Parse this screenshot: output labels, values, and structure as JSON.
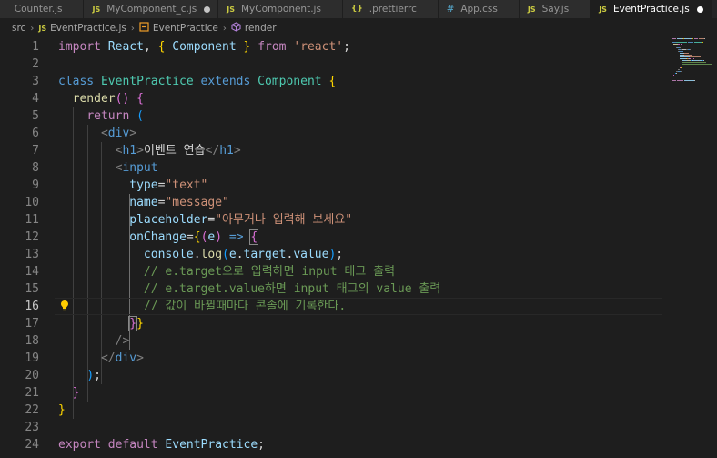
{
  "tabs": [
    {
      "label": "Counter.js",
      "icon": "js-file-icon",
      "active": false,
      "modified": false
    },
    {
      "label": "MyComponent_c.js",
      "icon": "js-file-icon",
      "active": false,
      "modified": true
    },
    {
      "label": "MyComponent.js",
      "icon": "js-file-icon",
      "active": false,
      "modified": false
    },
    {
      "label": ".prettierrc",
      "icon": "json-file-icon",
      "active": false,
      "modified": false
    },
    {
      "label": "App.css",
      "icon": "css-file-icon",
      "active": false,
      "modified": false
    },
    {
      "label": "Say.js",
      "icon": "js-file-icon",
      "active": false,
      "modified": false
    },
    {
      "label": "EventPractice.js",
      "icon": "js-file-icon",
      "active": true,
      "modified": true
    }
  ],
  "icon_glyphs": {
    "js": "JS",
    "json": "{}",
    "css": "#"
  },
  "breadcrumb": {
    "folder": "src",
    "file": "EventPractice.js",
    "class": "EventPractice",
    "method": "render"
  },
  "editor": {
    "current_line": 16,
    "colors": {
      "keyword": "#569cd6",
      "control": "#c586c0",
      "class": "#4ec9b0",
      "function": "#dcdcaa",
      "string": "#ce9178",
      "variable": "#9cdcfe",
      "comment": "#6a9955",
      "bracket_gold": "#ffd700",
      "bracket_orchid": "#da70d6",
      "bracket_blue": "#179fff"
    },
    "lines": [
      [
        [
          "kc",
          "import"
        ],
        [
          "txt",
          " "
        ],
        [
          "var",
          "React"
        ],
        [
          "txt",
          ", "
        ],
        [
          "b1",
          "{"
        ],
        [
          "txt",
          " "
        ],
        [
          "var",
          "Component"
        ],
        [
          "txt",
          " "
        ],
        [
          "b1",
          "}"
        ],
        [
          "txt",
          " "
        ],
        [
          "kc",
          "from"
        ],
        [
          "txt",
          " "
        ],
        [
          "str",
          "'react'"
        ],
        [
          "txt",
          ";"
        ]
      ],
      [],
      [
        [
          "kw",
          "class"
        ],
        [
          "txt",
          " "
        ],
        [
          "cls",
          "EventPractice"
        ],
        [
          "txt",
          " "
        ],
        [
          "kw",
          "extends"
        ],
        [
          "txt",
          " "
        ],
        [
          "cls",
          "Component"
        ],
        [
          "txt",
          " "
        ],
        [
          "b1",
          "{"
        ]
      ],
      [
        [
          "txt",
          "  "
        ],
        [
          "fn",
          "render"
        ],
        [
          "b2",
          "()"
        ],
        [
          "txt",
          " "
        ],
        [
          "b2",
          "{"
        ]
      ],
      [
        [
          "txt",
          "    "
        ],
        [
          "kc",
          "return"
        ],
        [
          "txt",
          " "
        ],
        [
          "b3",
          "("
        ]
      ],
      [
        [
          "txt",
          "      "
        ],
        [
          "punct",
          "<"
        ],
        [
          "tag",
          "div"
        ],
        [
          "punct",
          ">"
        ]
      ],
      [
        [
          "txt",
          "        "
        ],
        [
          "punct",
          "<"
        ],
        [
          "tag",
          "h1"
        ],
        [
          "punct",
          ">"
        ],
        [
          "txt",
          "이벤트 연습"
        ],
        [
          "punct",
          "</"
        ],
        [
          "tag",
          "h1"
        ],
        [
          "punct",
          ">"
        ]
      ],
      [
        [
          "txt",
          "        "
        ],
        [
          "punct",
          "<"
        ],
        [
          "tag",
          "input"
        ]
      ],
      [
        [
          "txt",
          "          "
        ],
        [
          "var",
          "type"
        ],
        [
          "txt",
          "="
        ],
        [
          "str",
          "\"text\""
        ]
      ],
      [
        [
          "txt",
          "          "
        ],
        [
          "var",
          "name"
        ],
        [
          "txt",
          "="
        ],
        [
          "str",
          "\"message\""
        ]
      ],
      [
        [
          "txt",
          "          "
        ],
        [
          "var",
          "placeholder"
        ],
        [
          "txt",
          "="
        ],
        [
          "str",
          "\"아무거나 입력해 보세요\""
        ]
      ],
      [
        [
          "txt",
          "          "
        ],
        [
          "var",
          "onChange"
        ],
        [
          "txt",
          "="
        ],
        [
          "b1",
          "{"
        ],
        [
          "b2",
          "("
        ],
        [
          "var",
          "e"
        ],
        [
          "b2",
          ")"
        ],
        [
          "txt",
          " "
        ],
        [
          "kw",
          "=>"
        ],
        [
          "txt",
          " "
        ],
        [
          "b2m",
          "{"
        ]
      ],
      [
        [
          "txt",
          "            "
        ],
        [
          "var",
          "console"
        ],
        [
          "txt",
          "."
        ],
        [
          "fn",
          "log"
        ],
        [
          "b3",
          "("
        ],
        [
          "var",
          "e"
        ],
        [
          "txt",
          "."
        ],
        [
          "var",
          "target"
        ],
        [
          "txt",
          "."
        ],
        [
          "var",
          "value"
        ],
        [
          "b3",
          ")"
        ],
        [
          "txt",
          ";"
        ]
      ],
      [
        [
          "txt",
          "            "
        ],
        [
          "cmt",
          "// e.target으로 입력하면 input 태그 출력"
        ]
      ],
      [
        [
          "txt",
          "            "
        ],
        [
          "cmt",
          "// e.target.value하면 input 태그의 value 출력"
        ]
      ],
      [
        [
          "txt",
          "            "
        ],
        [
          "cmt",
          "// 값이 바뀔때마다 콘솔에 기록한다."
        ]
      ],
      [
        [
          "txt",
          "          "
        ],
        [
          "b2m",
          "}"
        ],
        [
          "b1",
          "}"
        ]
      ],
      [
        [
          "txt",
          "        "
        ],
        [
          "punct",
          "/>"
        ]
      ],
      [
        [
          "txt",
          "      "
        ],
        [
          "punct",
          "</"
        ],
        [
          "tag",
          "div"
        ],
        [
          "punct",
          ">"
        ]
      ],
      [
        [
          "txt",
          "    "
        ],
        [
          "b3",
          ")"
        ],
        [
          "txt",
          ";"
        ]
      ],
      [
        [
          "txt",
          "  "
        ],
        [
          "b2",
          "}"
        ]
      ],
      [
        [
          "b1",
          "}"
        ]
      ],
      [],
      [
        [
          "kc",
          "export"
        ],
        [
          "txt",
          " "
        ],
        [
          "kc",
          "default"
        ],
        [
          "txt",
          " "
        ],
        [
          "var",
          "EventPractice"
        ],
        [
          "txt",
          ";"
        ]
      ]
    ]
  }
}
